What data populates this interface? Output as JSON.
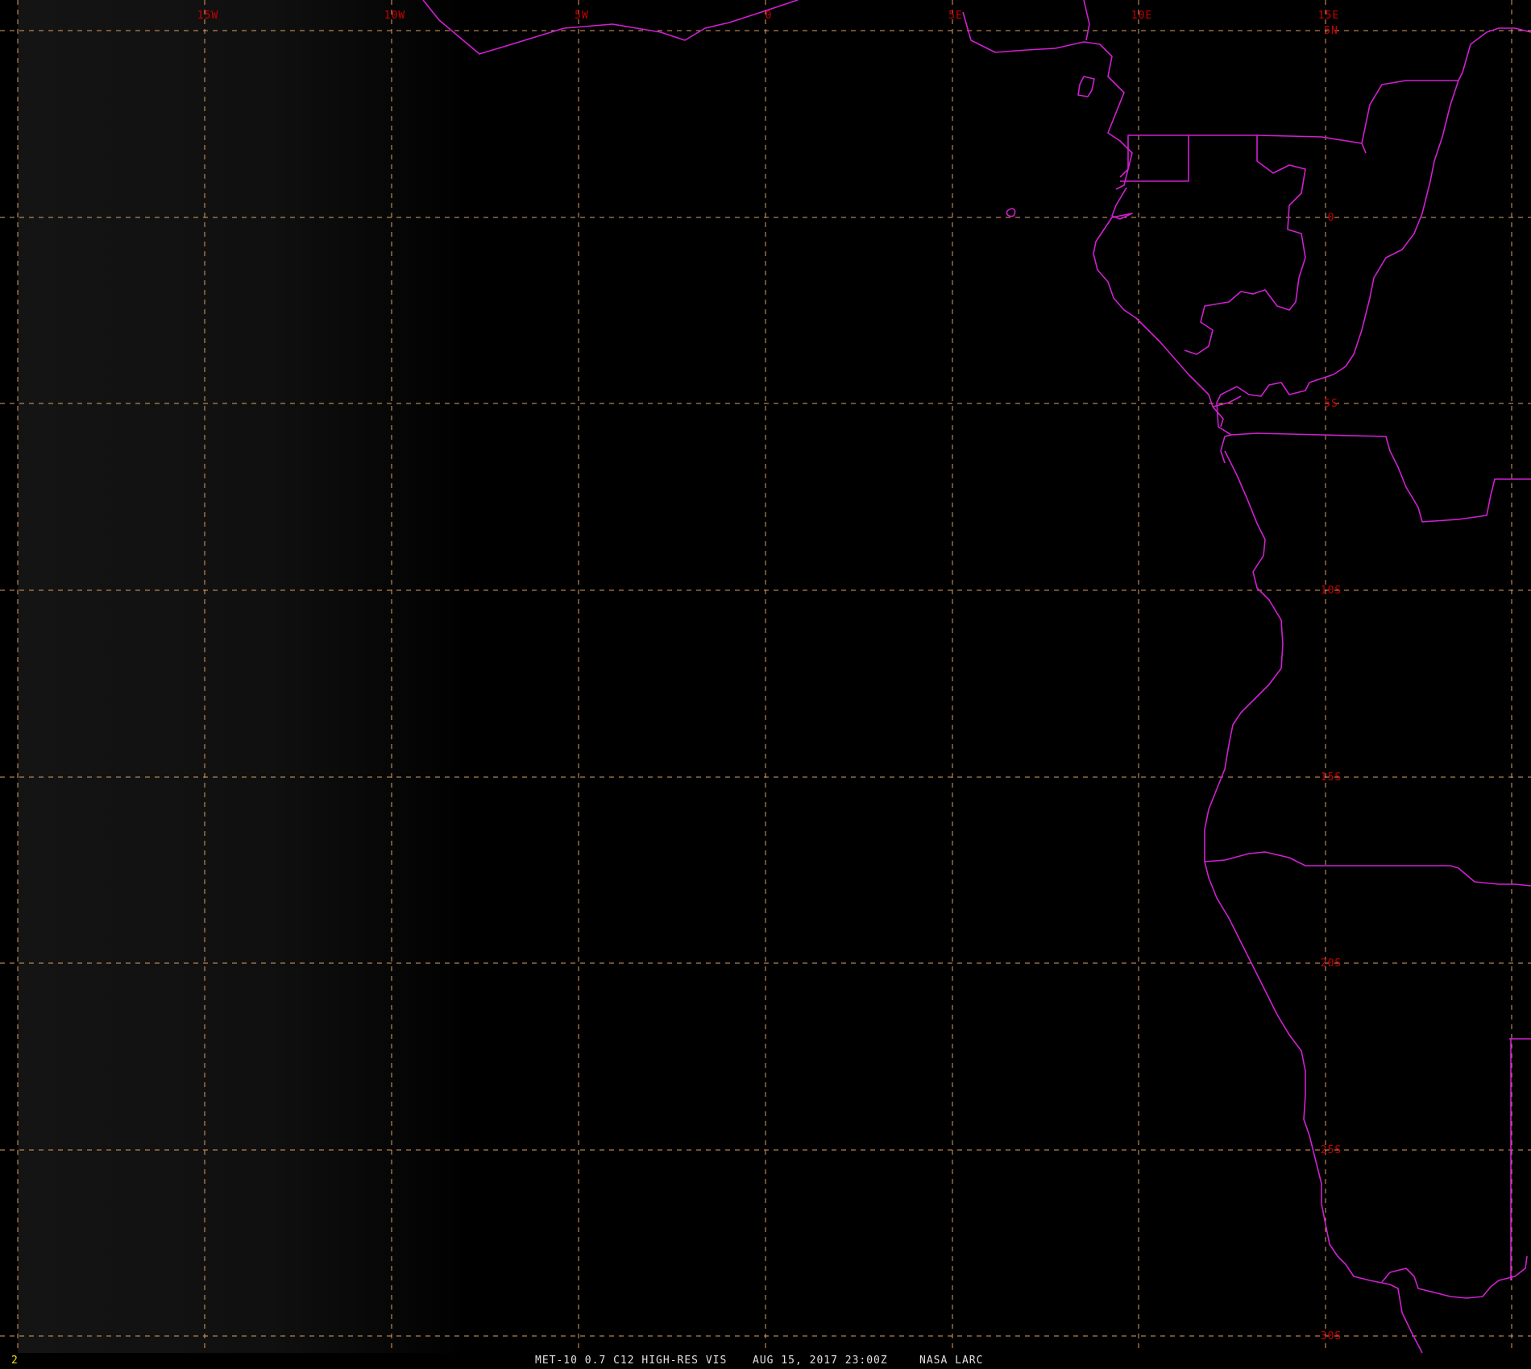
{
  "window": {
    "frame_index": "2",
    "caption": {
      "satellite_product": "MET-10 0.7 C12 HIGH-RES VIS",
      "datetime": "AUG 15, 2017 23:00Z",
      "organization": "NASA LARC"
    }
  },
  "map": {
    "projection": "geostationary satellite view",
    "background_color": "#000000",
    "grid_color": "#e0a060",
    "grid_style": "dashed",
    "label_color": "#c80000",
    "coastline_color": "#d020d0",
    "longitude_labels": [
      "15W",
      "10W",
      "5W",
      "0",
      "5E",
      "10E",
      "15E"
    ],
    "latitude_labels": [
      "5N",
      "0",
      "5S",
      "10S",
      "15S",
      "20S",
      "25S",
      "30S"
    ]
  }
}
